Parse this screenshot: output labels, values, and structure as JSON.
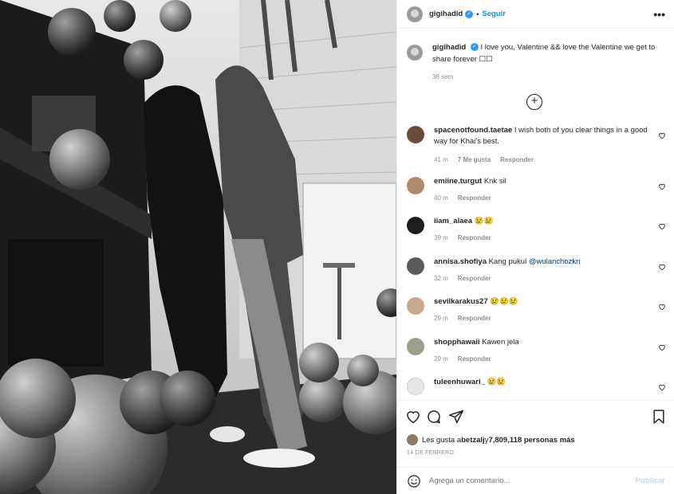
{
  "post": {
    "username": "gigihadid",
    "follow_label": "Seguir",
    "separator": "•",
    "more_label": "•••",
    "caption": "I love you, Valentine && love the Valentine we get to share forever ☐☐",
    "caption_time": "36 sem",
    "load_more_label": "+"
  },
  "comments": [
    {
      "user": "spacenotfound.taetae",
      "text": "I wish both of you clear things in a good way for Khai's best.",
      "time": "41 m",
      "likes": "7 Me gusta",
      "reply": "Responder",
      "avatar_color": "#6b4a3a"
    },
    {
      "user": "emiine.turgut",
      "text": "Knk sil",
      "time": "40 m",
      "likes": "",
      "reply": "Responder",
      "avatar_color": "#b08a6a"
    },
    {
      "user": "iiam_alaea",
      "text": "😢😢",
      "time": "39 m",
      "likes": "",
      "reply": "Responder",
      "avatar_color": "#1e1e1e"
    },
    {
      "user": "annisa.shofiya",
      "text": "Kang pukul ",
      "mention": "@wulanchozkn",
      "time": "32 m",
      "likes": "",
      "reply": "Responder",
      "avatar_color": "#5a5a5a"
    },
    {
      "user": "sevilkarakus27",
      "text": "😢😢😢",
      "time": "29 m",
      "likes": "",
      "reply": "Responder",
      "avatar_color": "#c9a88a"
    },
    {
      "user": "shopphawaii",
      "text": "Kawen jela",
      "time": "29 m",
      "likes": "",
      "reply": "Responder",
      "avatar_color": "#9aa08a"
    },
    {
      "user": "tuleenhuwari_",
      "text": "😢😢",
      "time": "",
      "likes": "",
      "reply": "",
      "avatar_color": "#e6e6e6"
    }
  ],
  "footer": {
    "likes_prefix": "Les gusta a ",
    "likes_user": "betzalj",
    "likes_middle": " y ",
    "likes_count": "7,809,118 personas más",
    "date": "14 DE FEBRERO",
    "comment_placeholder": "Agrega un comentario...",
    "publish_label": "Publicar"
  },
  "icons": [
    "verified-icon",
    "more-options-icon",
    "load-more-icon",
    "heart-icon",
    "comment-icon",
    "share-icon",
    "bookmark-icon",
    "emoji-icon",
    "like-comment-icon"
  ],
  "colors": {
    "accent": "#0095f6",
    "muted": "#8e8e8e",
    "text": "#262626",
    "border": "#efefef",
    "publish_disabled": "#b3dbff"
  }
}
